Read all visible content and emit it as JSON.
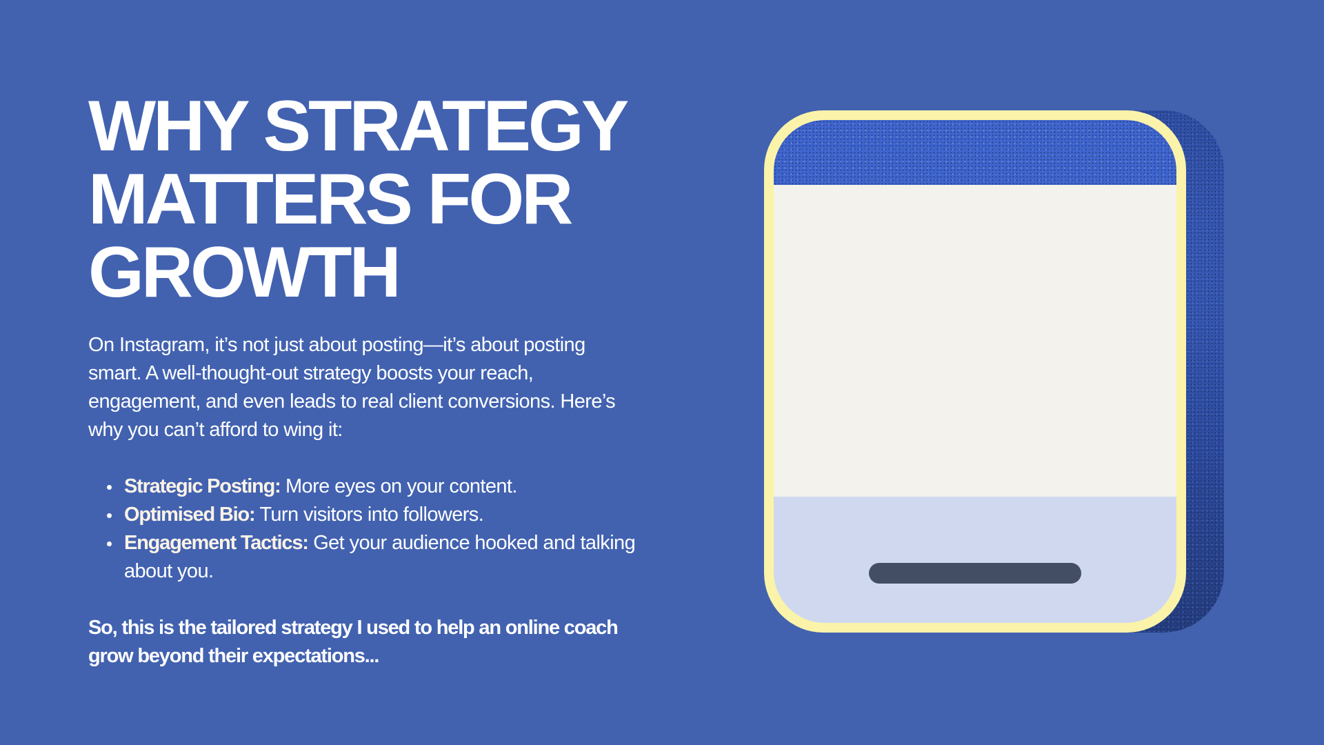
{
  "headline": {
    "lines": [
      "WHY STRATEGY",
      "MATTERS FOR",
      "GROWTH"
    ]
  },
  "intro": {
    "text": "On Instagram, it’s not just about posting—it’s about posting smart. A well-thought-out strategy boosts your reach, engagement, and even leads to real client conversions. Here’s why you can’t afford to wing it:"
  },
  "bullets": [
    {
      "lead": "Strategic Posting:",
      "text": " More eyes on your content."
    },
    {
      "lead": "Optimised Bio:",
      "text": " Turn visitors into followers."
    },
    {
      "lead": "Engagement Tactics:",
      "text": " Get your audience hooked and talking about you."
    }
  ],
  "closing": {
    "text": "So, this is the tailored strategy I used to help an online coach grow beyond their expectations..."
  },
  "colors": {
    "background": "#4262b0",
    "device_frame": "#fbf3a9",
    "device_top": "#3f66d0",
    "device_body": "#f4f2ec",
    "device_bottom": "#cfd8ee",
    "home_bar": "#434e65"
  },
  "illustration": {
    "icon": "phone-device-icon"
  }
}
